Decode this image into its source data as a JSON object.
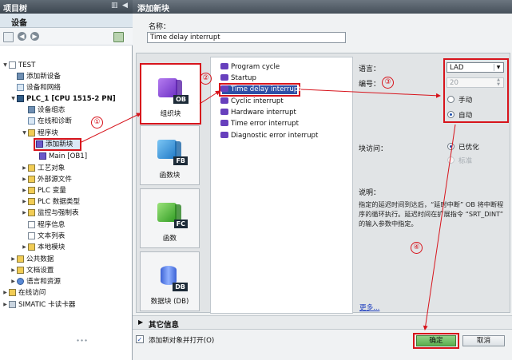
{
  "project_tree": {
    "title": "项目树",
    "tab": "设备",
    "items": [
      {
        "label": "TEST"
      },
      {
        "label": "添加新设备"
      },
      {
        "label": "设备和网络"
      },
      {
        "label": "PLC_1 [CPU 1515-2 PN]"
      },
      {
        "label": "设备组态"
      },
      {
        "label": "在线和诊断"
      },
      {
        "label": "程序块"
      },
      {
        "label": "添加新块"
      },
      {
        "label": "Main [OB1]"
      },
      {
        "label": "工艺对象"
      },
      {
        "label": "外部源文件"
      },
      {
        "label": "PLC 变量"
      },
      {
        "label": "PLC 数据类型"
      },
      {
        "label": "监控与强制表"
      },
      {
        "label": "程序信息"
      },
      {
        "label": "文本列表"
      },
      {
        "label": "本地模块"
      },
      {
        "label": "公共数据"
      },
      {
        "label": "文档设置"
      },
      {
        "label": "语言和资源"
      },
      {
        "label": "在线访问"
      },
      {
        "label": "SIMATIC 卡读卡器"
      }
    ]
  },
  "dialog": {
    "title": "添加新块",
    "name_label": "名称：",
    "name_value": "Time delay interrupt",
    "categories": [
      {
        "tag": "OB",
        "label": "组织块"
      },
      {
        "tag": "FB",
        "label": "函数块"
      },
      {
        "tag": "FC",
        "label": "函数"
      },
      {
        "tag": "DB",
        "label": "数据块 (DB)"
      }
    ],
    "block_types": [
      "Program cycle",
      "Startup",
      "Time delay interrupt",
      "Cyclic interrupt",
      "Hardware interrupt",
      "Time error interrupt",
      "Diagnostic error interrupt"
    ],
    "language_label": "语言：",
    "language_value": "LAD",
    "number_label": "编号：",
    "number_value": "20",
    "manual_label": "手动",
    "auto_label": "自动",
    "access_label": "块访问：",
    "optimized_label": "已优化",
    "standard_label": "标准",
    "description_label": "说明：",
    "description_text": "指定的延迟时间到达后，“延时中断” OB 将中断程序的循环执行。延迟时间在扩展指令 “SRT_DINT” 的输入参数中指定。",
    "more_link": "更多...",
    "other_info": "其它信息",
    "open_after_add": "添加新对象并打开(O)",
    "ok": "确定",
    "cancel": "取消"
  },
  "annotations": [
    "①",
    "②",
    "③",
    "④"
  ],
  "colors": {
    "annotation_red": "#d7141c",
    "selection_blue": "#2e4fa6",
    "ok_green": "#5cae4e"
  }
}
